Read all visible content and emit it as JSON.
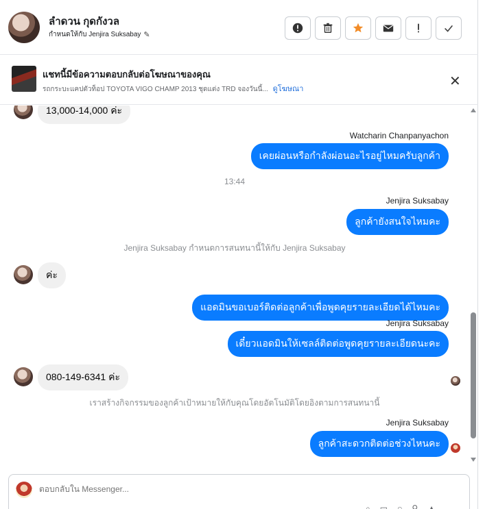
{
  "header": {
    "contact_name": "ลำดวน กุดกังวล",
    "assigned_text": "กำหนดให้กับ Jenjira Suksabay",
    "actions": [
      {
        "name": "spam-button",
        "icon": "alert-circle-icon",
        "glyph": "!"
      },
      {
        "name": "delete-button",
        "icon": "trash-icon",
        "glyph": ""
      },
      {
        "name": "star-button",
        "icon": "star-icon",
        "glyph": "★"
      },
      {
        "name": "mail-button",
        "icon": "envelope-icon",
        "glyph": "✉"
      },
      {
        "name": "follow-up-button",
        "icon": "exclamation-icon",
        "glyph": "!"
      },
      {
        "name": "done-button",
        "icon": "check-icon",
        "glyph": "✓"
      }
    ]
  },
  "ad": {
    "title": "แชทนี้มีข้อความตอบกลับต่อโฆษณาของคุณ",
    "subtitle": "รถกระบะแคปตัวท็อป TOYOTA VIGO CHAMP 2013 ชุดแต่ง TRD จองวันนี้...",
    "link": "ดูโฆษณา",
    "close": "✕"
  },
  "messages": {
    "m1": "13,000-14,000 ค่ะ",
    "sender1": "Watcharin Chanpanyachon",
    "m2": "เคยผ่อนหรือกำลังผ่อนอะไรอยู่ไหมครับลูกค้า",
    "time1": "13:44",
    "sender2": "Jenjira Suksabay",
    "m3": "ลูกค้ายังสนใจไหมคะ",
    "sys1": "Jenjira Suksabay กำหนดการสนทนานี้ให้กับ Jenjira Suksabay",
    "m4": "ค่ะ",
    "m5": "แอดมินขอเบอร์ติดต่อลูกค้าเพื่อพูดคุยรายละเอียดได้ไหมคะ",
    "sender3": "Jenjira Suksabay",
    "m6": "เดี๋ยวแอดมินให้เซลล์ติดต่อพูดคุยรายละเอียดนะคะ",
    "m7": "080-149-6341 ค่ะ",
    "sys2": "เราสร้างกิจกรรมของลูกค้าเป้าหมายให้กับคุณโดยอัตโนมัติโดยอิงตามการสนทนานี้",
    "sender4": "Jenjira Suksabay",
    "m8": "ลูกค้าสะดวกติดต่อช่วงไหนคะ"
  },
  "composer": {
    "placeholder": "ตอบกลับใน Messenger..."
  },
  "colors": {
    "outgoing_bubble": "#0a7cff",
    "incoming_bubble": "#f0f0f0",
    "star": "#f28c28"
  }
}
